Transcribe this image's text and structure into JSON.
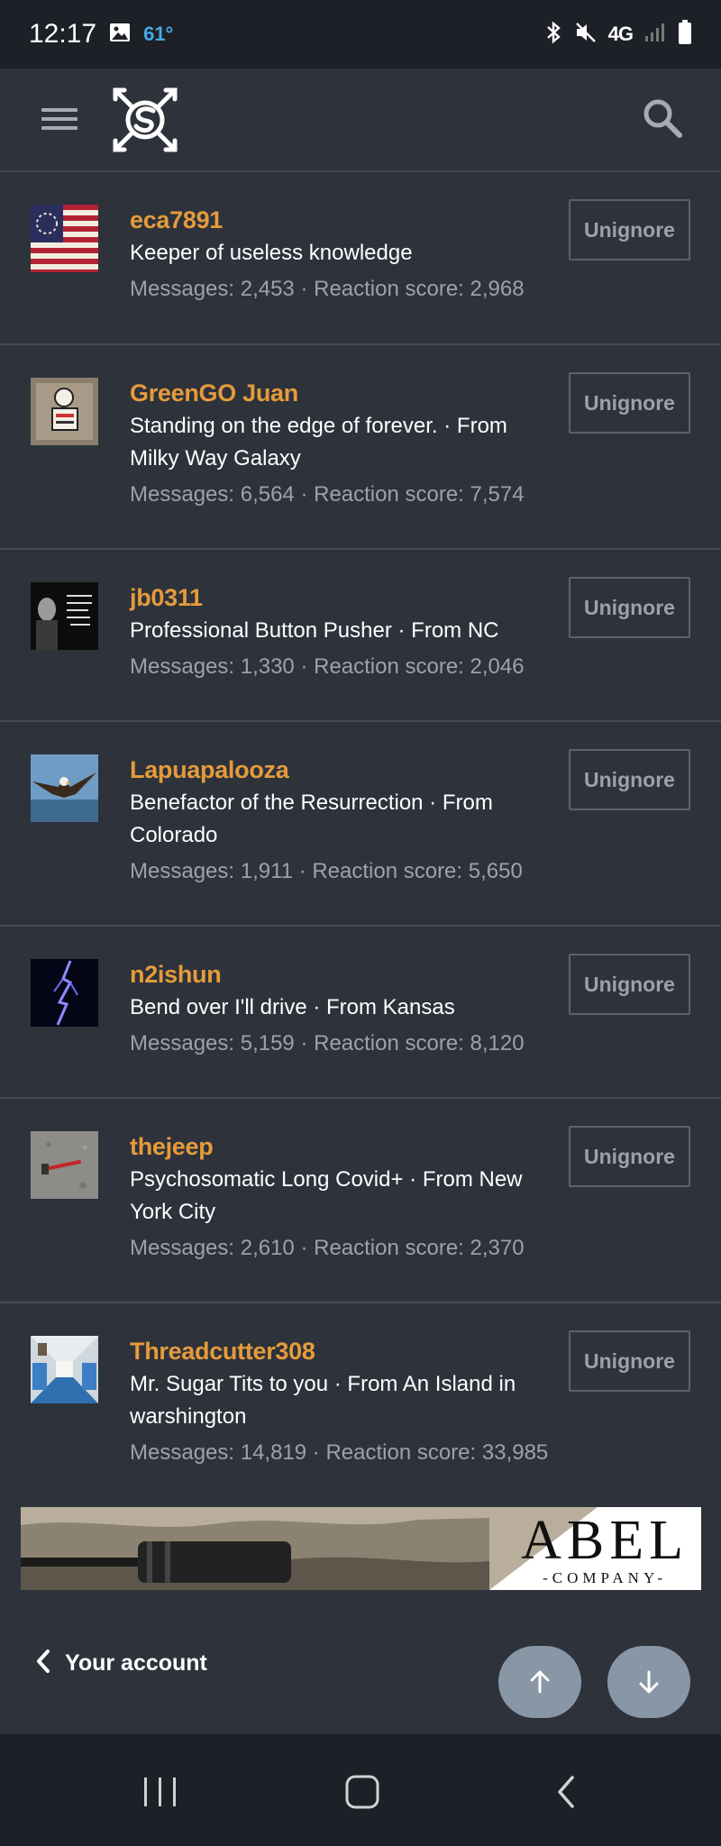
{
  "status_bar": {
    "time": "12:17",
    "temperature": "61°",
    "network": "4G"
  },
  "header": {
    "menu_icon": "hamburger-menu-icon",
    "logo": "crossed-arrows-logo",
    "search_icon": "search-icon"
  },
  "members": [
    {
      "name": "eca7891",
      "title": "Keeper of useless knowledge",
      "stats": "Messages: 2,453 · Reaction score: 2,968",
      "button": "Unignore",
      "avatar": "us-flag-avatar"
    },
    {
      "name": "GreenGO Juan",
      "title": "Standing on the edge of forever. · From Milky Way Galaxy",
      "stats": "Messages: 6,564 · Reaction score: 7,574",
      "button": "Unignore",
      "avatar": "sticker-avatar"
    },
    {
      "name": "jb0311",
      "title": "Professional Button Pusher · From NC",
      "stats": "Messages: 1,330 · Reaction score: 2,046",
      "button": "Unignore",
      "avatar": "quote-avatar"
    },
    {
      "name": "Lapuapalooza",
      "title": "Benefactor of the Resurrection · From Colorado",
      "stats": "Messages: 1,911 · Reaction score: 5,650",
      "button": "Unignore",
      "avatar": "eagle-avatar"
    },
    {
      "name": "n2ishun",
      "title": "Bend over I'll drive · From Kansas",
      "stats": "Messages: 5,159 · Reaction score: 8,120",
      "button": "Unignore",
      "avatar": "lightning-avatar"
    },
    {
      "name": "thejeep",
      "title": "Psychosomatic Long Covid+ · From New York City",
      "stats": "Messages: 2,610 · Reaction score: 2,370",
      "button": "Unignore",
      "avatar": "hammer-avatar"
    },
    {
      "name": "Threadcutter308",
      "title": "Mr. Sugar Tits to you · From An Island in warshington",
      "stats": "Messages: 14,819 · Reaction score: 33,985",
      "button": "Unignore",
      "avatar": "train-interior-avatar"
    }
  ],
  "ad": {
    "brand": "ABEL",
    "sub": "-COMPANY-"
  },
  "footer": {
    "account_label": "Your account",
    "scroll_up_icon": "arrow-up-icon",
    "scroll_down_icon": "arrow-down-icon"
  },
  "colors": {
    "background": "#2d323b",
    "username": "#e59b3b",
    "muted_text": "#9ca2ab",
    "scroll_button": "#8996a5"
  }
}
